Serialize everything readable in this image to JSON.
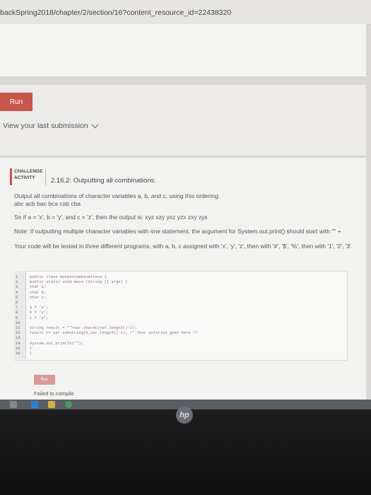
{
  "browser": {
    "url": "backSpring2018/chapter/2/section/16?content_resource_id=22438320"
  },
  "run_section": {
    "run_label": "Run",
    "view_link": "View your last submission"
  },
  "challenge": {
    "badge_line1": "CHALLENGE",
    "badge_line2": "ACTIVITY",
    "title": "2.16.2: Outputting all combinations.",
    "desc1": "Output all combinations of character variables a, b, and c, using this ordering:",
    "desc2": "abc acb bac bca cab cba",
    "example": "So if a = 'x', b = 'y', and c = 'z', then the output is: xyz xzy yxz yzx zxy zyx",
    "note": "Note: If outputting multiple character variables with one statement, the argument for System.out.print() should start with \"\" +",
    "testing": "Your code will be tested in three different programs, with a, b, c assigned with 'x', 'y', 'z', then with '#', '$', '%', then with '1', '2', '3'."
  },
  "code": {
    "lines": [
      {
        "n": "1",
        "text": "public class OutputCombinations {"
      },
      {
        "n": "2",
        "text": "   public static void main (String [] args) {"
      },
      {
        "n": "3",
        "text": "      char a;"
      },
      {
        "n": "4",
        "text": "      char b;"
      },
      {
        "n": "5",
        "text": "      char c;"
      },
      {
        "n": "6",
        "text": ""
      },
      {
        "n": "7",
        "text": "      a = 'x';"
      },
      {
        "n": "8",
        "text": "      b = 'y';"
      },
      {
        "n": "9",
        "text": "      c = 'z';"
      },
      {
        "n": "10",
        "text": ""
      },
      {
        "n": "11",
        "text": "      String result = \"\"+var.charAt(var.length()-1);"
      },
      {
        "n": "12",
        "text": "      result += var.substring(0,var.length()-1); /* Your solution goes here */"
      },
      {
        "n": "13",
        "text": ""
      },
      {
        "n": "14",
        "text": "      System.out.println(\"\");"
      },
      {
        "n": "15",
        "text": "   }"
      },
      {
        "n": "16",
        "text": "}"
      }
    ],
    "run_label": "Run",
    "status": "Failed to compile"
  },
  "taskbar": {
    "logo": "hp"
  },
  "colors": {
    "accent": "#c9564a",
    "code_text": "#8a6d92"
  }
}
